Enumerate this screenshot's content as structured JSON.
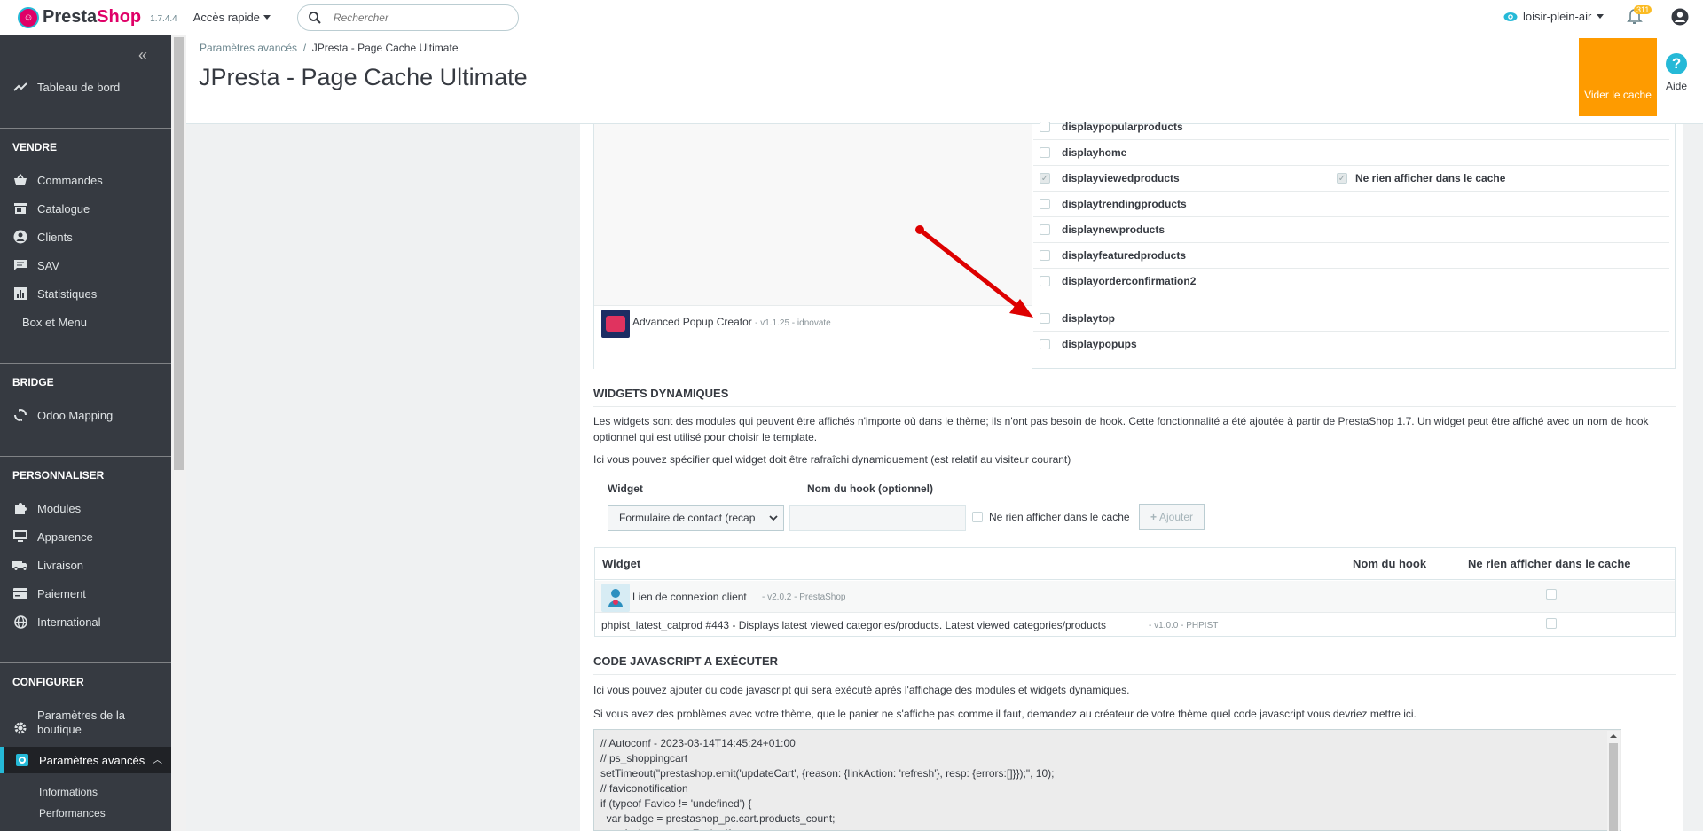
{
  "topbar": {
    "brand_presta": "Presta",
    "brand_shop": "Shop",
    "version": "1.7.4.4",
    "quick_access": "Accès rapide",
    "search_placeholder": "Rechercher",
    "shop_name": "loisir-plein-air",
    "notifications_count": "311"
  },
  "sidebar": {
    "dashboard": "Tableau de bord",
    "sections": {
      "sell": "VENDRE",
      "bridge": "BRIDGE",
      "customize": "PERSONNALISER",
      "configure": "CONFIGURER"
    },
    "sell_items": [
      "Commandes",
      "Catalogue",
      "Clients",
      "SAV",
      "Statistiques",
      "Box et Menu"
    ],
    "bridge_items": [
      "Odoo Mapping"
    ],
    "customize_items": [
      "Modules",
      "Apparence",
      "Livraison",
      "Paiement",
      "International"
    ],
    "configure_items": [
      "Paramètres de la boutique",
      "Paramètres avancés"
    ],
    "sub_items": [
      "Informations",
      "Performances"
    ]
  },
  "header": {
    "breadcrumb_parent": "Paramètres avancés",
    "breadcrumb_sep": "/",
    "breadcrumb_current": "JPresta - Page Cache Ultimate",
    "title": "JPresta - Page Cache Ultimate",
    "clear_cache": "Vider le cache",
    "help": "Aide"
  },
  "hooks": {
    "rows": [
      {
        "name": "displaypopularproducts",
        "checked": false
      },
      {
        "name": "displayhome",
        "checked": false
      },
      {
        "name": "displayviewedproducts",
        "checked": true,
        "extra": "Ne rien afficher dans le cache"
      },
      {
        "name": "displaytrendingproducts",
        "checked": false
      },
      {
        "name": "displaynewproducts",
        "checked": false
      },
      {
        "name": "displayfeaturedproducts",
        "checked": false
      },
      {
        "name": "displayorderconfirmation2",
        "checked": false
      },
      {
        "name": "displaytop",
        "checked": false
      },
      {
        "name": "displaypopups",
        "checked": false
      }
    ],
    "module_name": "Advanced Popup Creator",
    "module_meta": "- v1.1.25  - idnovate"
  },
  "widgets": {
    "title": "WIDGETS DYNAMIQUES",
    "desc1": "Les widgets sont des modules qui peuvent être affichés n'importe où dans le thème; ils n'ont pas besoin de hook. Cette fonctionnalité a été ajoutée à partir de PrestaShop 1.7. Un widget peut être affiché avec un nom de hook optionnel qui est utilisé pour choisir le template.",
    "desc2": "Ici vous pouvez spécifier quel widget doit être rafraîchi dynamiquement (est relatif au visiteur courant)",
    "label_widget": "Widget",
    "label_hook": "Nom du hook (optionnel)",
    "select_value": "Formulaire de contact (recap",
    "no_cache_label": "Ne rien afficher dans le cache",
    "add_button": "Ajouter",
    "table_headers": [
      "Widget",
      "Nom du hook",
      "Ne rien afficher dans le cache"
    ],
    "table_rows": [
      {
        "name": "Lien de connexion client",
        "meta": "- v2.0.2  - PrestaShop"
      },
      {
        "name": "phpist_latest_catprod #443 - Displays latest viewed categories/products. Latest viewed categories/products",
        "meta": "- v1.0.0  - PHPIST"
      }
    ]
  },
  "javascript": {
    "title": "CODE JAVASCRIPT A EXÉCUTER",
    "desc1": "Ici vous pouvez ajouter du code javascript qui sera exécuté après l'affichage des modules et widgets dynamiques.",
    "desc2": "Si vous avez des problèmes avec votre thème, que le panier ne s'affiche pas comme il faut, demandez au créateur de votre thème quel code javascript vous devriez mettre ici.",
    "code": "// Autoconf - 2023-03-14T14:45:24+01:00\n// ps_shoppingcart\nsetTimeout(\"prestashop.emit('updateCart', {reason: {linkAction: 'refresh'}, resp: {errors:[]}});\", 10);\n// faviconotification\nif (typeof Favico != 'undefined') {\n  var badge = prestashop_pc.cart.products_count;\n  var favicon = new Favico({"
  }
}
